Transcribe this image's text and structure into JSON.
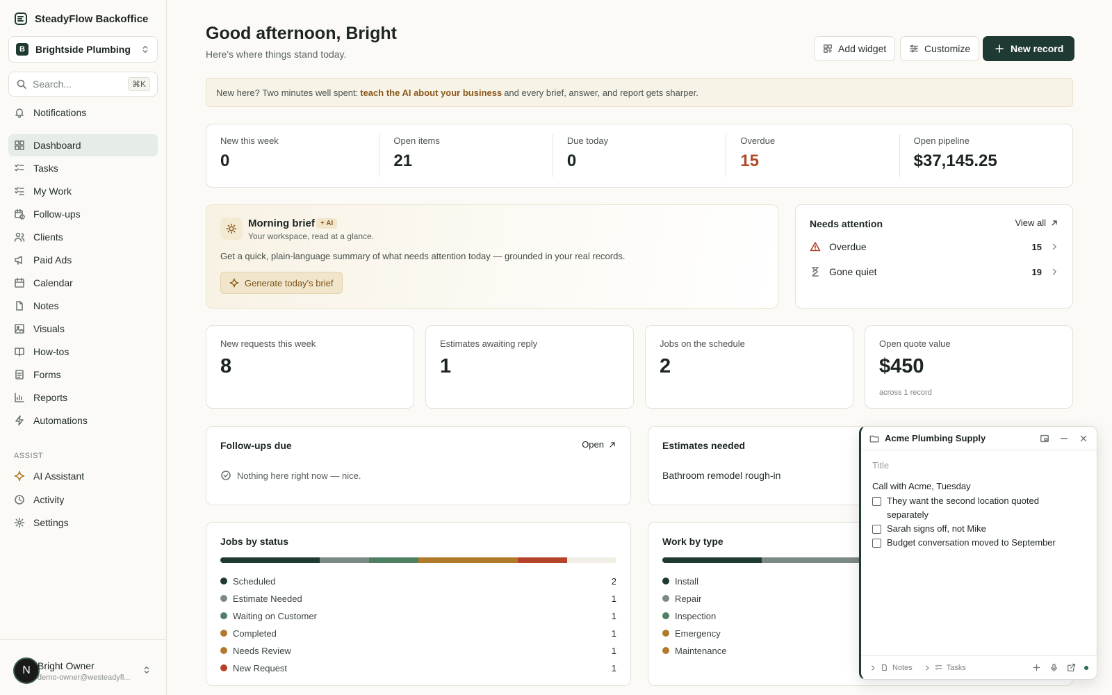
{
  "app": {
    "name": "SteadyFlow Backoffice"
  },
  "workspace": {
    "name": "Brightside Plumbing ...",
    "initial": "B"
  },
  "search": {
    "placeholder": "Search...",
    "shortcut": "⌘K"
  },
  "sidebar": {
    "notifications": "Notifications",
    "items": [
      {
        "label": "Dashboard",
        "icon": "dashboard-icon",
        "active": true
      },
      {
        "label": "Tasks",
        "icon": "tasks-icon"
      },
      {
        "label": "My Work",
        "icon": "my-work-icon"
      },
      {
        "label": "Follow-ups",
        "icon": "calendar-clock-icon"
      },
      {
        "label": "Clients",
        "icon": "users-icon"
      },
      {
        "label": "Paid Ads",
        "icon": "megaphone-icon"
      },
      {
        "label": "Calendar",
        "icon": "calendar-icon"
      },
      {
        "label": "Notes",
        "icon": "file-icon"
      },
      {
        "label": "Visuals",
        "icon": "image-icon"
      },
      {
        "label": "How-tos",
        "icon": "book-icon"
      },
      {
        "label": "Forms",
        "icon": "form-icon"
      },
      {
        "label": "Reports",
        "icon": "chart-icon"
      },
      {
        "label": "Automations",
        "icon": "bolt-icon"
      }
    ],
    "assist_label": "ASSIST",
    "assist_items": [
      {
        "label": "AI Assistant",
        "icon": "sparkle-icon"
      },
      {
        "label": "Activity",
        "icon": "clock-icon"
      },
      {
        "label": "Settings",
        "icon": "gear-icon"
      }
    ]
  },
  "user": {
    "name": "Bright Owner",
    "email": "demo-owner@westeadyfl...",
    "initial": "N"
  },
  "header": {
    "greeting": "Good afternoon, Bright",
    "subtitle": "Here's where things stand today.",
    "add_widget": "Add widget",
    "customize": "Customize",
    "new_record": "New record"
  },
  "banner": {
    "pre": "New here? Two minutes well spent:",
    "link": "teach the AI about your business",
    "post": "and every brief, answer, and report gets sharper."
  },
  "stats": [
    {
      "label": "New this week",
      "value": "0"
    },
    {
      "label": "Open items",
      "value": "21"
    },
    {
      "label": "Due today",
      "value": "0"
    },
    {
      "label": "Overdue",
      "value": "15",
      "alert": true
    },
    {
      "label": "Open pipeline",
      "value": "$37,145.25"
    }
  ],
  "brief": {
    "title": "Morning brief",
    "badge": "+ AI",
    "subtitle": "Your workspace, read at a glance.",
    "text": "Get a quick, plain-language summary of what needs attention today — grounded in your real records.",
    "button": "Generate today's brief"
  },
  "attention": {
    "title": "Needs attention",
    "view_all": "View all",
    "rows": [
      {
        "label": "Overdue",
        "count": "15",
        "icon": "warning-icon"
      },
      {
        "label": "Gone quiet",
        "count": "19",
        "icon": "hourglass-icon"
      }
    ]
  },
  "kpis": [
    {
      "label": "New requests this week",
      "value": "8",
      "sub": ""
    },
    {
      "label": "Estimates awaiting reply",
      "value": "1",
      "sub": ""
    },
    {
      "label": "Jobs on the schedule",
      "value": "2",
      "sub": ""
    },
    {
      "label": "Open quote value",
      "value": "$450",
      "sub": "across 1 record"
    }
  ],
  "followups": {
    "title": "Follow-ups due",
    "open": "Open",
    "empty": "Nothing here right now — nice."
  },
  "estimates": {
    "title": "Estimates needed",
    "item": "Bathroom remodel rough-in"
  },
  "jobs_by_status": {
    "title": "Jobs by status",
    "items": [
      {
        "name": "Scheduled",
        "count": 2,
        "color": "#1f3a33"
      },
      {
        "name": "Estimate Needed",
        "count": 1,
        "color": "#7b8a82"
      },
      {
        "name": "Waiting on Customer",
        "count": 1,
        "color": "#4f8063"
      },
      {
        "name": "Completed",
        "count": 1,
        "color": "#b07a2a"
      },
      {
        "name": "Needs Review",
        "count": 1,
        "color": "#b07a2a"
      },
      {
        "name": "New Request",
        "count": 1,
        "color": "#b4432a"
      }
    ]
  },
  "work_by_type": {
    "title": "Work by type",
    "items": [
      {
        "name": "Install",
        "color": "#1f3a33"
      },
      {
        "name": "Repair",
        "color": "#7b8a82"
      },
      {
        "name": "Inspection",
        "color": "#4f8063"
      },
      {
        "name": "Emergency",
        "color": "#b07a2a"
      },
      {
        "name": "Maintenance",
        "color": "#b07a2a"
      }
    ]
  },
  "note_panel": {
    "title": "Acme Plumbing Supply",
    "title_placeholder": "Title",
    "heading": "Call with Acme, Tuesday",
    "checklist": [
      "They want the second location quoted separately",
      "Sarah signs off, not Mike",
      "Budget conversation moved to September"
    ],
    "footer_notes": "Notes",
    "footer_tasks": "Tasks"
  }
}
